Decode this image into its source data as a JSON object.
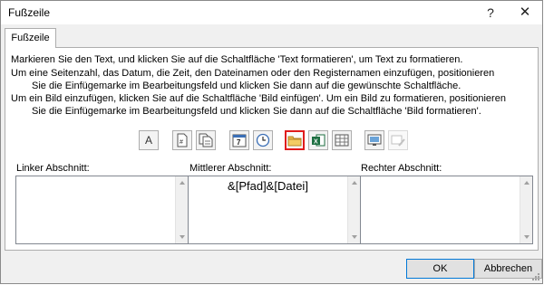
{
  "window": {
    "title": "Fußzeile",
    "help_glyph": "?",
    "close_glyph": "✕"
  },
  "tab": {
    "label": "Fußzeile"
  },
  "instructions": [
    "Markieren Sie den Text, und klicken Sie auf die Schaltfläche 'Text formatieren', um Text zu formatieren.",
    "Um eine Seitenzahl, das Datum, die Zeit, den Dateinamen oder den Registernamen einzufügen, positionieren",
    "Sie die Einfügemarke im Bearbeitungsfeld und klicken Sie dann auf die gewünschte Schaltfläche.",
    "Um ein Bild einzufügen, klicken Sie auf die Schaltfläche 'Bild einfügen'. Um ein Bild zu formatieren, positionieren",
    "Sie die Einfügemarke im Bearbeitungsfeld und klicken Sie dann auf die Schaltfläche 'Bild formatieren'."
  ],
  "toolbar": {
    "buttons": [
      {
        "name": "format-text",
        "glyph": "A"
      },
      {
        "name": "insert-page-number",
        "glyph": "#"
      },
      {
        "name": "insert-page-count"
      },
      {
        "name": "insert-date",
        "glyph": "7"
      },
      {
        "name": "insert-time"
      },
      {
        "name": "insert-file-path",
        "selected": true
      },
      {
        "name": "insert-file-name",
        "glyph": "X"
      },
      {
        "name": "insert-sheet-name"
      },
      {
        "name": "insert-picture"
      },
      {
        "name": "format-picture",
        "disabled": true
      }
    ],
    "selected_border_color": "#e01c1c"
  },
  "sections": {
    "left": {
      "label": "Linker Abschnitt:",
      "value": ""
    },
    "center": {
      "label": "Mittlerer Abschnitt:",
      "value": "&[Pfad]&[Datei]"
    },
    "right": {
      "label": "Rechter Abschnitt:",
      "value": ""
    }
  },
  "buttons": {
    "ok": "OK",
    "cancel": "Abbrechen"
  },
  "colors": {
    "dialog_bg": "#f0f0f0",
    "accent": "#0078d7",
    "excel_green": "#1d6f42"
  }
}
